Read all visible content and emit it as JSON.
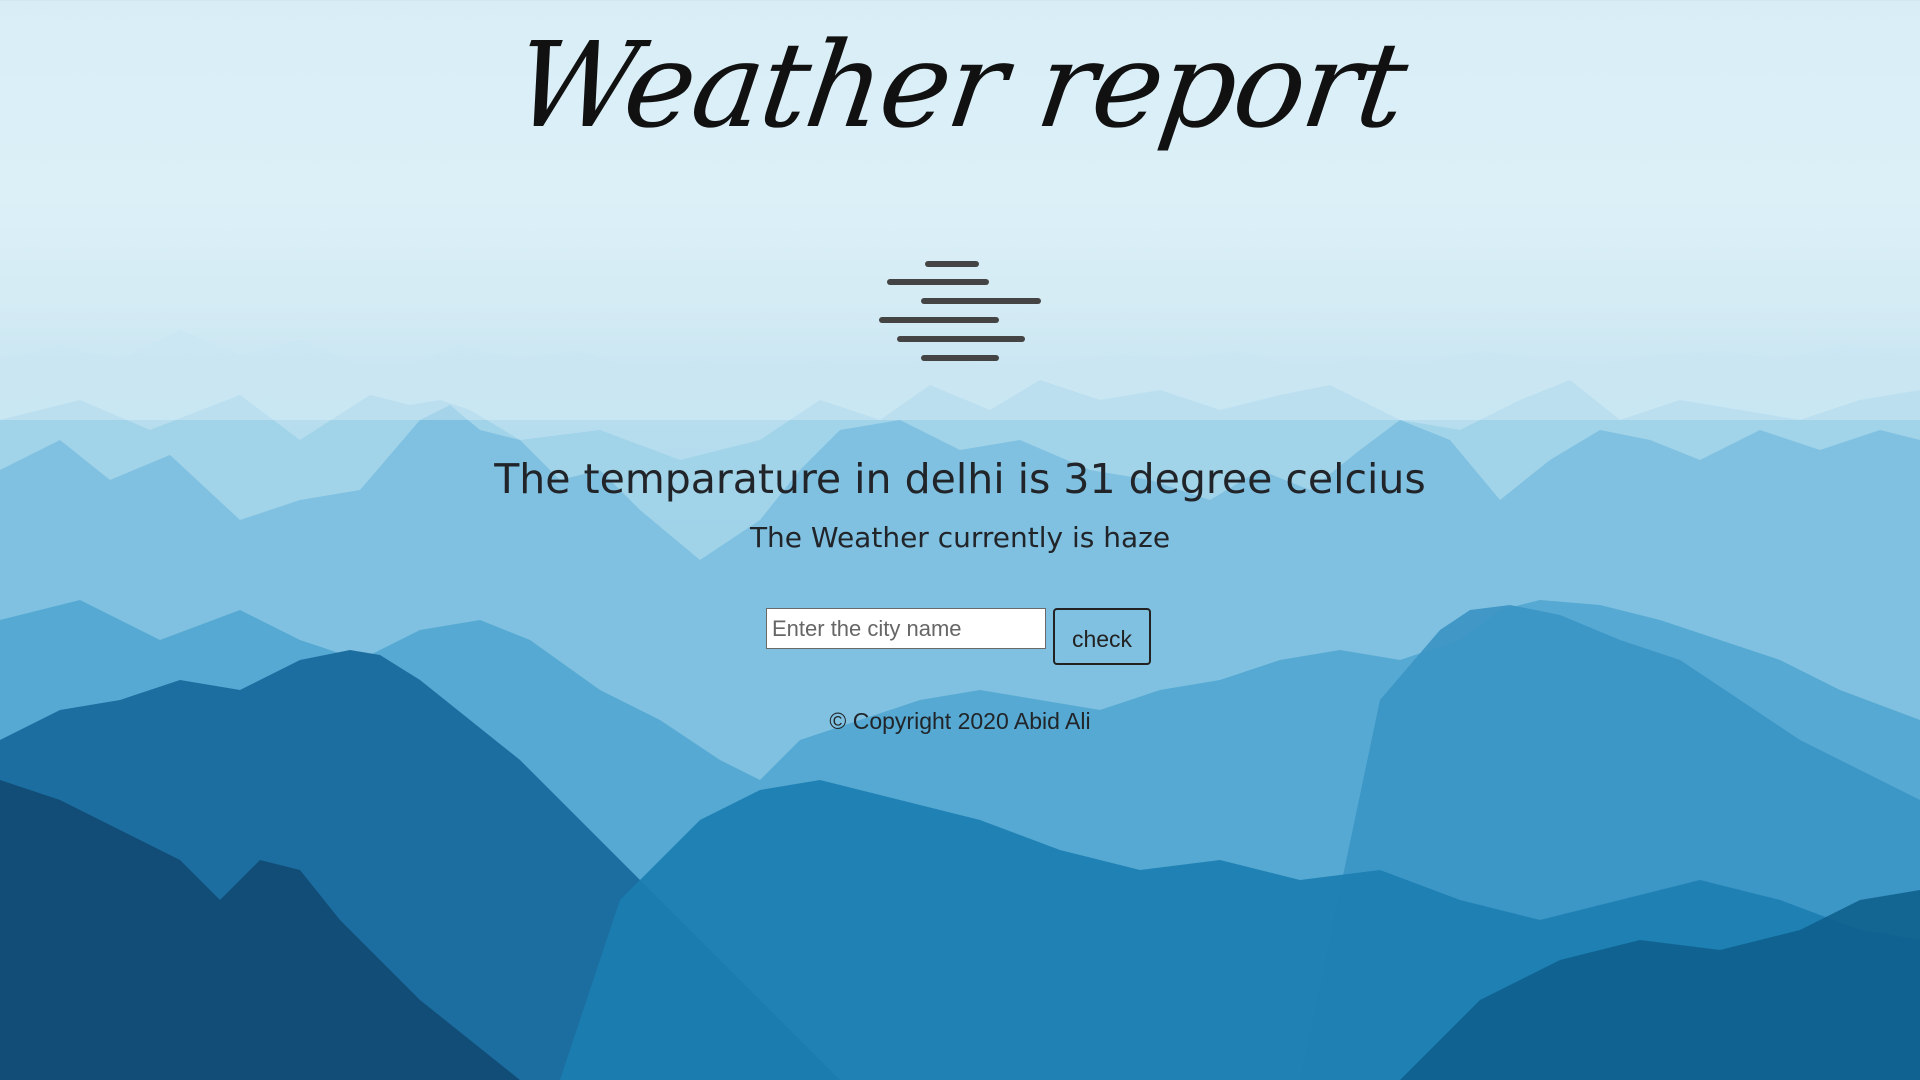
{
  "header": {
    "title": "Weather report"
  },
  "weather": {
    "icon": "haze-icon",
    "temperature_text": "The temparature in delhi is 31 degree celcius",
    "condition_text": "The Weather currently is haze"
  },
  "search": {
    "placeholder": "Enter the city name",
    "value": "",
    "button_label": "check"
  },
  "footer": {
    "copyright": "© Copyright 2020 Abid Ali"
  },
  "colors": {
    "text": "#212529",
    "icon": "#444444",
    "sky_top": "#cfe9f3",
    "mountain_deep": "#0f4f7a"
  }
}
